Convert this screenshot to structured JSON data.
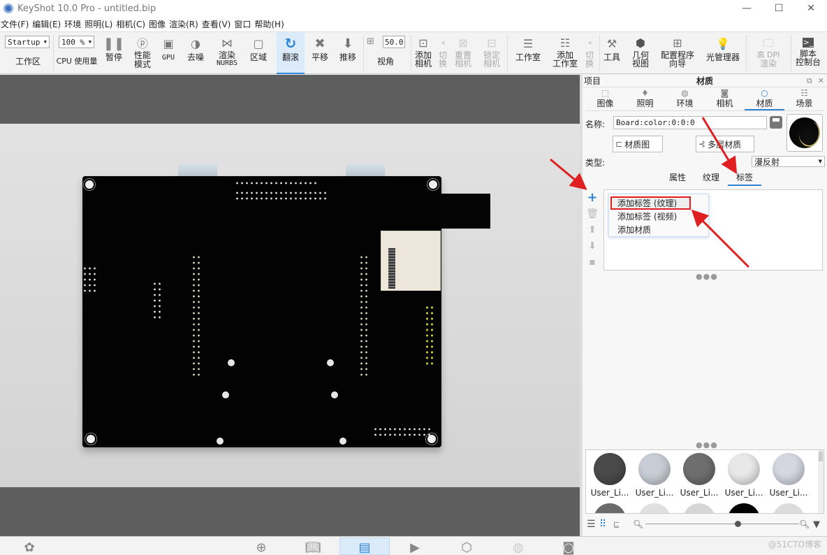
{
  "window": {
    "title": "KeyShot 10.0 Pro  - untitled.bip",
    "minimize": "—",
    "maximize": "☐",
    "close": "✕"
  },
  "menu": [
    "文件(F)",
    "编辑(E)",
    "环境",
    "照明(L)",
    "相机(C)",
    "图像",
    "渲染(R)",
    "查看(V)",
    "窗口",
    "帮助(H)"
  ],
  "toolbar": {
    "workspace_value": "Startup",
    "workspace_label": "工作区",
    "cpu_value": "100 %",
    "cpu_label": "CPU 使用量",
    "pause": "暂停",
    "perf_mode": "性能\n模式",
    "gpu": "GPU",
    "denoise": "去噪",
    "render_nurbs_1": "渲染",
    "render_nurbs_2": "NURBS",
    "region": "区域",
    "tumble": "翻滚",
    "pan": "平移",
    "dolly": "推移",
    "fov_value": "50.0",
    "fov_label": "视角",
    "add_camera_1": "添加",
    "add_camera_2": "相机",
    "switch_1": "切",
    "switch_2": "换",
    "reset_camera_1": "重置",
    "reset_camera_2": "相机",
    "lock_camera_1": "锁定",
    "lock_camera_2": "相机",
    "studio": "工作室",
    "add_studio_1": "添加",
    "add_studio_2": "工作室",
    "switch2_1": "切",
    "switch2_2": "换",
    "tools": "工具",
    "geo_view_1": "几何",
    "geo_view_2": "视图",
    "config_1": "配置程序",
    "config_2": "向导",
    "light_mgr": "光管理器",
    "hidpi_1": "高 DPI",
    "hidpi_2": "渲染",
    "script_1": "脚本",
    "script_2": "控制台"
  },
  "panel": {
    "left_title": "项目",
    "title": "材质",
    "tabs": [
      {
        "label": "图像",
        "icon": "image-icon"
      },
      {
        "label": "照明",
        "icon": "lighting-icon"
      },
      {
        "label": "环境",
        "icon": "environment-icon"
      },
      {
        "label": "相机",
        "icon": "camera-icon"
      },
      {
        "label": "材质",
        "icon": "material-icon",
        "active": true
      },
      {
        "label": "场景",
        "icon": "scene-icon"
      }
    ],
    "name_label": "名称:",
    "name_value": "Board:color:0:0:0",
    "material_graph": "材质图",
    "multi_material": "多层材质",
    "type_label": "类型:",
    "type_value": "漫反射",
    "sub_tabs": [
      "属性",
      "纹理",
      "标签"
    ],
    "active_sub_tab": "标签",
    "context_menu": [
      "添加标签 (纹理)",
      "添加标签 (视频)",
      "添加材质"
    ],
    "library_items": [
      "User_Li...",
      "User_Li...",
      "User_Li...",
      "User_Li...",
      "User_Li..."
    ],
    "library_colors": [
      "#4a4a4a",
      "#c8ccd4",
      "#6e6e6e",
      "#e8e8e8",
      "#d4d6e0"
    ],
    "library_row2_colors": [
      "#6a6a6a",
      "#e0e0e0",
      "#d6d6d6",
      "#000000",
      "#dcdcdc"
    ],
    "zoom_level": 0.6
  },
  "watermark": "@51CTO博客"
}
